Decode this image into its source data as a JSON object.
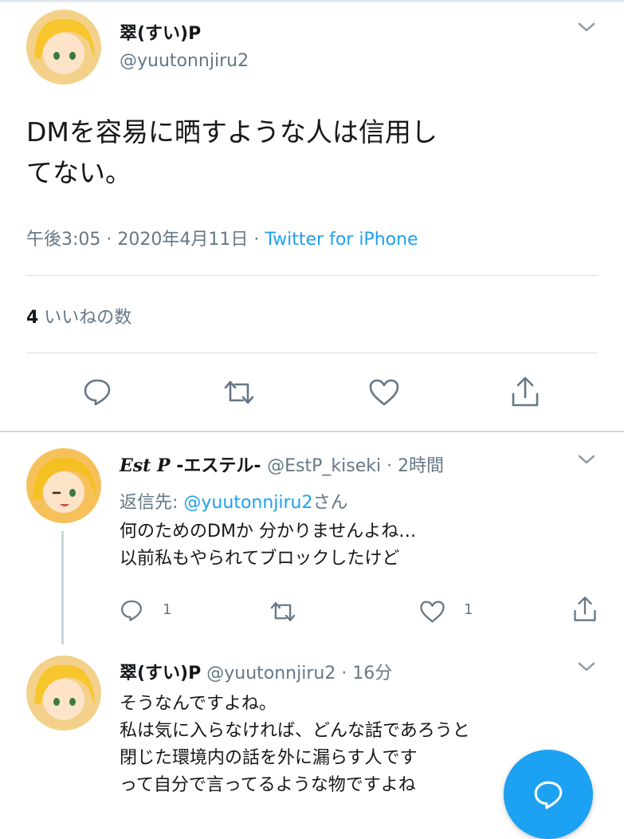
{
  "main_tweet": {
    "display_name": "翠(すい)P",
    "handle": "@yuutonnjiru2",
    "text": "DMを容易に晒すような人は信用し\nてない。",
    "timestamp": "午後3:05 · 2020年4月11日 · ",
    "source": "Twitter for iPhone",
    "likes_count": "4",
    "likes_label": " いいねの数"
  },
  "replies": [
    {
      "display_name_styled": "Est P",
      "display_name_rest": " -エステル- ",
      "handle_time": "@EstP_kiseki · 2時間",
      "reply_to_prefix": "返信先: ",
      "reply_to_handle": "@yuutonnjiru2",
      "reply_to_suffix": "さん",
      "text": "何のためのDMか 分かりませんよね…\n以前私もやられてブロックしたけど",
      "reply_count": "1",
      "like_count": "1"
    },
    {
      "display_name": "翠(すい)P",
      "handle_time": " @yuutonnjiru2 · 16分",
      "text": "そうなんですよね。\n私は気に入らなければ、どんな話であろうと\n閉じた環境内の話を外に漏らす人です\nって自分で言ってるような物ですよね"
    }
  ],
  "colors": {
    "accent": "#1da1f2",
    "secondary_text": "#657786",
    "primary_text": "#14171a"
  },
  "icons": [
    "chevron-down-icon",
    "reply-icon",
    "retweet-icon",
    "like-icon",
    "share-icon",
    "compose-reply-icon"
  ]
}
